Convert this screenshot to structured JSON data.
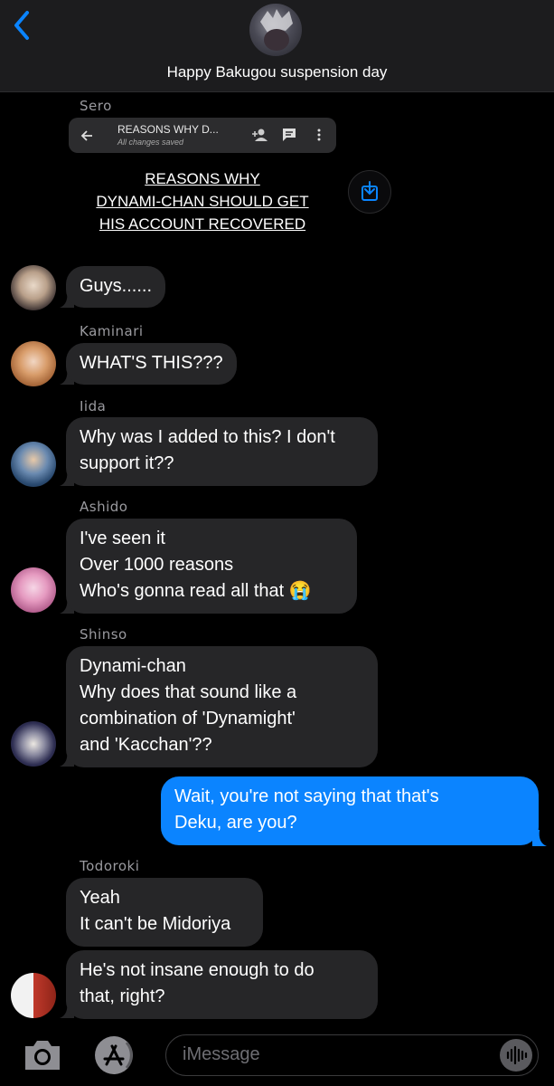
{
  "header": {
    "title": "Happy Bakugou suspension day"
  },
  "document": {
    "bar_title": "REASONS WHY D...",
    "bar_subtitle": "All changes saved",
    "body_lines": [
      "REASONS WHY",
      "DYNAMI-CHAN SHOULD GET",
      "HIS ACCOUNT RECOVERED"
    ]
  },
  "messages": [
    {
      "sender": "Sero"
    },
    {
      "text": "Guys......"
    },
    {
      "sender": "Kaminari",
      "text": "WHAT'S THIS???"
    },
    {
      "sender": "Iida",
      "text": "Why was I added to this? I don't\nsupport it??"
    },
    {
      "sender": "Ashido",
      "text": "I've seen it\nOver 1000 reasons\nWho's gonna read all that 😭"
    },
    {
      "sender": "Shinso",
      "text": "Dynami-chan\nWhy does that sound like a\ncombination of 'Dynamight'\nand  'Kacchan'??"
    },
    {
      "text": "Wait, you're not saying that that's\nDeku, are you?"
    },
    {
      "sender": "Todoroki",
      "text": "Yeah\nIt can't be Midoriya"
    },
    {
      "text": "He's not insane enough to do\nthat, right?"
    }
  ],
  "composer": {
    "placeholder": "iMessage"
  },
  "colors": {
    "outgoing_bubble": "#0b84ff",
    "incoming_bubble": "#262628",
    "accent": "#0a84ff"
  }
}
